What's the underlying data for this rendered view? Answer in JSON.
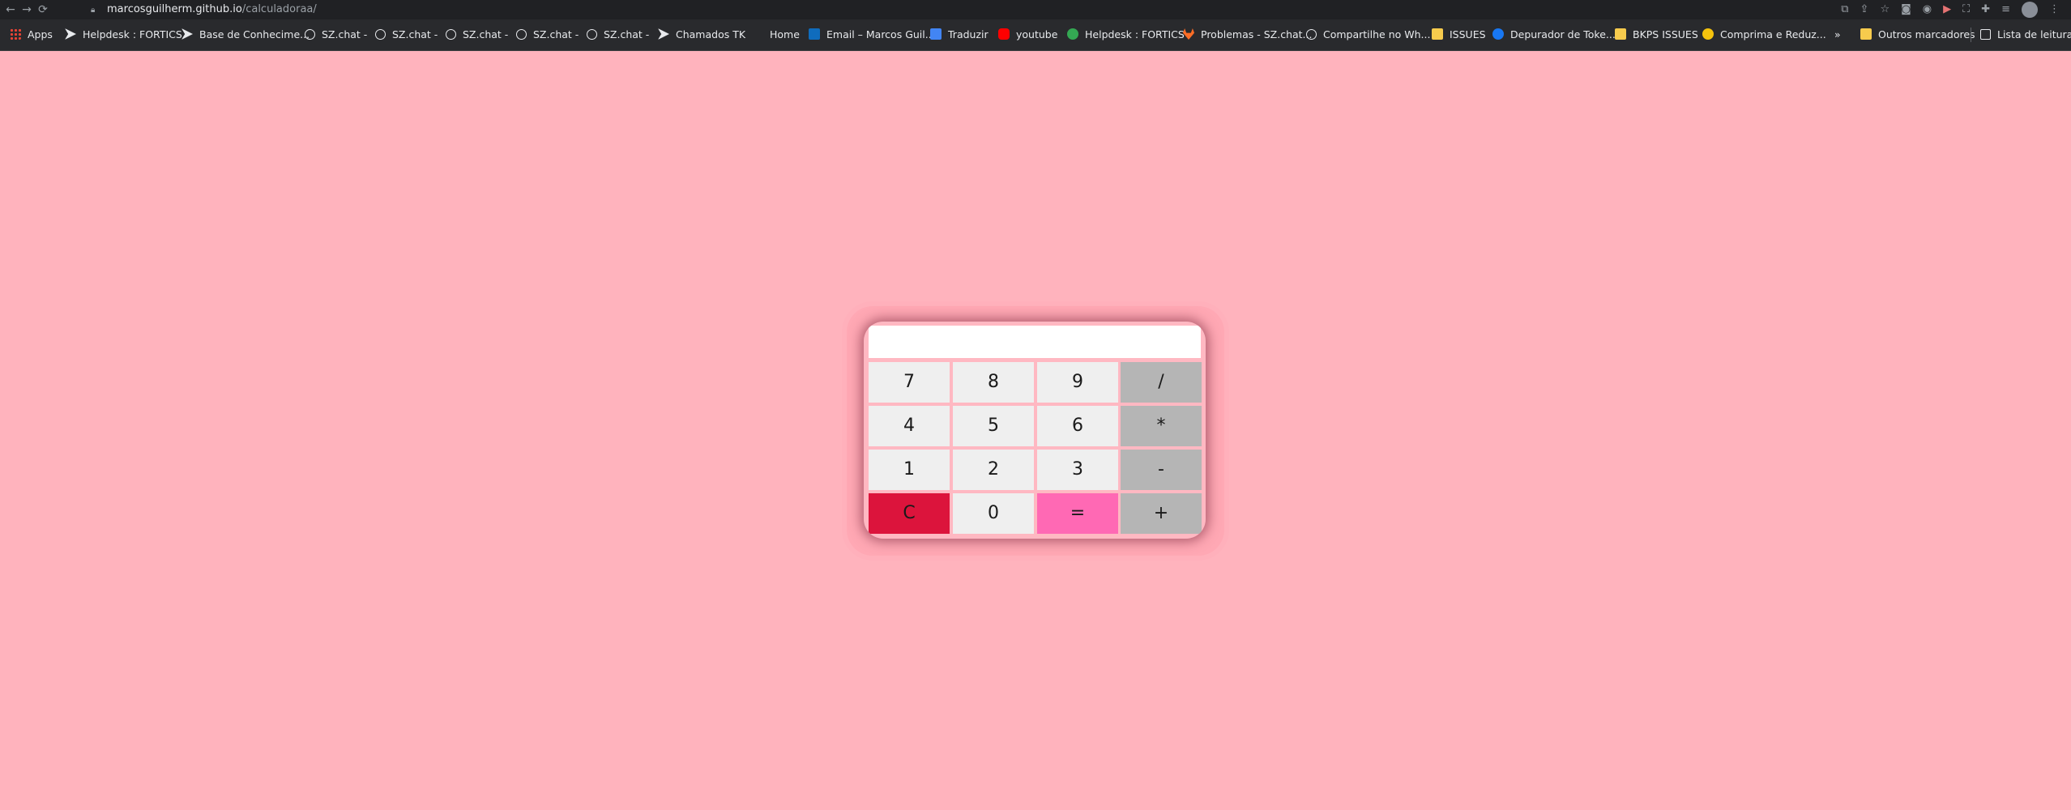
{
  "browser": {
    "url_host": "marcosguilherm.github.io",
    "url_path": "/calculadoraa/",
    "nav": {
      "back_icon": "←",
      "forward_icon": "→",
      "reload_icon": "⟳"
    }
  },
  "bookmarks": [
    {
      "label": "Apps",
      "icon": "apps-grid-icon"
    },
    {
      "label": "Helpdesk : FORTICS",
      "icon": "fortics-icon"
    },
    {
      "label": "Base de Conhecime...",
      "icon": "fortics-icon"
    },
    {
      "label": "SZ.chat -",
      "icon": "globe-icon"
    },
    {
      "label": "SZ.chat -",
      "icon": "globe-icon"
    },
    {
      "label": "SZ.chat -",
      "icon": "globe-icon"
    },
    {
      "label": "SZ.chat -",
      "icon": "globe-icon"
    },
    {
      "label": "SZ.chat -",
      "icon": "globe-icon"
    },
    {
      "label": "Chamados TK",
      "icon": "fortics-icon"
    },
    {
      "label": "Home",
      "icon": "blank-icon"
    },
    {
      "label": "Email – Marcos Guil...",
      "icon": "outlook-icon"
    },
    {
      "label": "Traduzir",
      "icon": "translate-icon"
    },
    {
      "label": "youtube",
      "icon": "youtube-icon"
    },
    {
      "label": "Helpdesk : FORTICS",
      "icon": "green-circle-icon"
    },
    {
      "label": "Problemas - SZ.chat...",
      "icon": "gitlab-icon"
    },
    {
      "label": "Compartilhe no Wh...",
      "icon": "globe-icon"
    },
    {
      "label": "ISSUES",
      "icon": "folder-icon"
    },
    {
      "label": "Depurador de Toke...",
      "icon": "facebook-icon"
    },
    {
      "label": "BKPS ISSUES",
      "icon": "folder-icon"
    },
    {
      "label": "Comprima e Reduz...",
      "icon": "yellow-circle-icon"
    },
    {
      "label": "»",
      "icon": "none"
    },
    {
      "label": "Outros marcadores",
      "icon": "folder-icon"
    },
    {
      "label": "Lista de leitura",
      "icon": "reading-list-icon"
    }
  ],
  "calculator": {
    "display_value": "",
    "keys": {
      "k7": "7",
      "k8": "8",
      "k9": "9",
      "div": "/",
      "k4": "4",
      "k5": "5",
      "k6": "6",
      "mul": "*",
      "k1": "1",
      "k2": "2",
      "k3": "3",
      "sub": "-",
      "clear": "C",
      "k0": "0",
      "eq": "=",
      "add": "+"
    },
    "colors": {
      "page_bg": "#ffb3bd",
      "number_key": "#efefef",
      "operator_key": "#b5b5b5",
      "clear_key": "#dc143c",
      "equals_key": "#ff69b4"
    }
  }
}
